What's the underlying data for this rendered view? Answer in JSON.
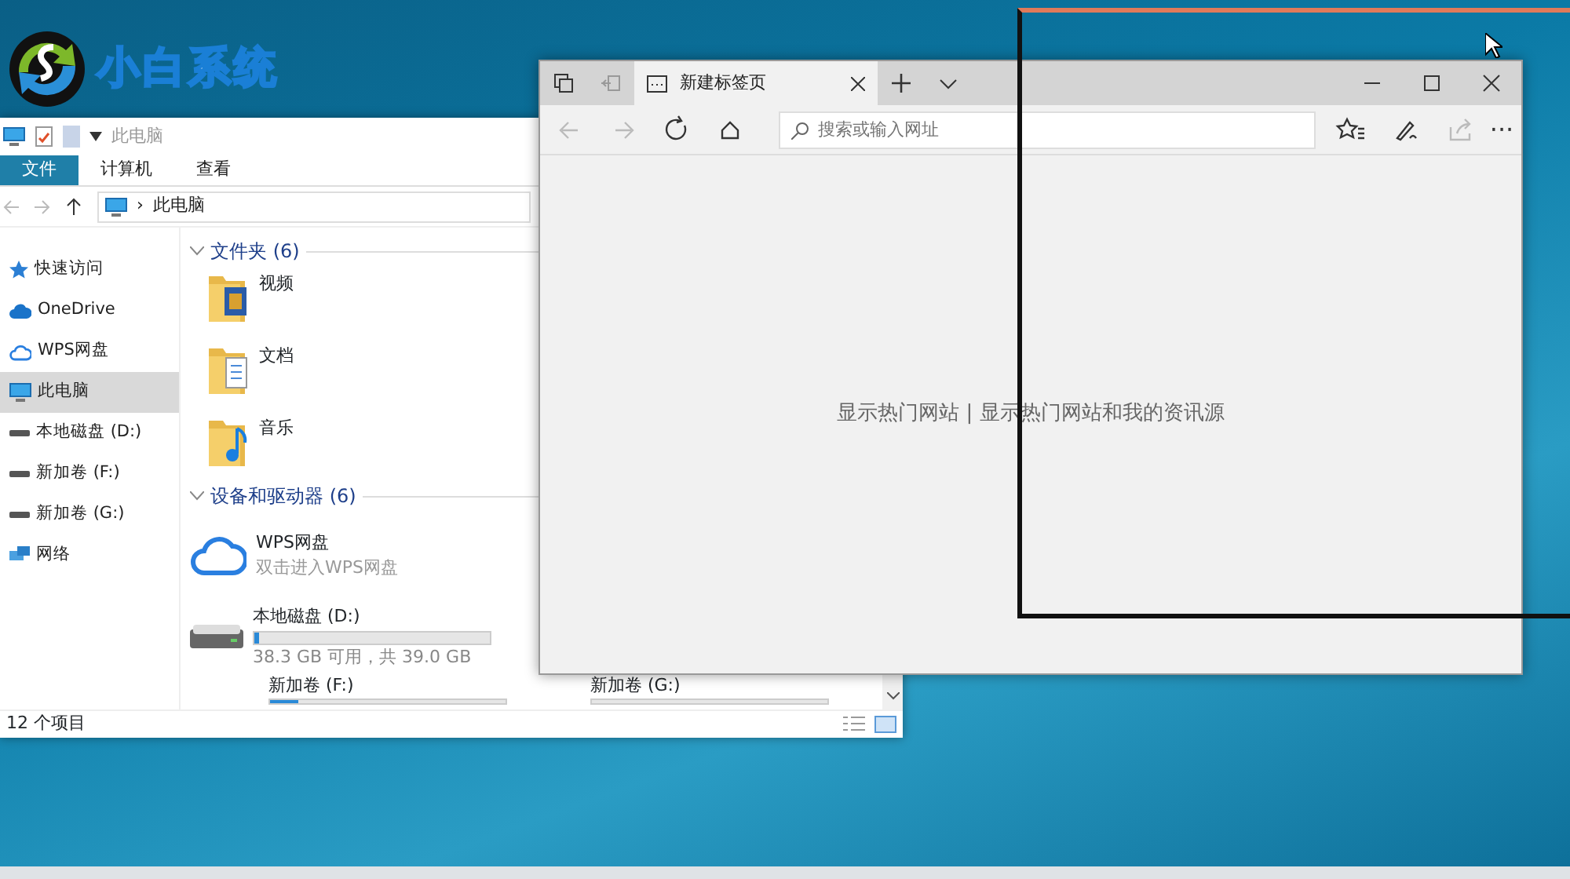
{
  "logo": {
    "text": "小白系统"
  },
  "explorer": {
    "title": "此电脑",
    "ribbon_tabs": [
      {
        "label": "文件",
        "selected": true
      },
      {
        "label": "计算机",
        "selected": false
      },
      {
        "label": "查看",
        "selected": false
      }
    ],
    "address": {
      "separator": "›",
      "path": "此电脑"
    },
    "sidebar": [
      {
        "label": "快速访问",
        "kind": "star",
        "selected": false
      },
      {
        "label": "OneDrive",
        "kind": "cloud",
        "selected": false
      },
      {
        "label": "WPS网盘",
        "kind": "cloudoutline",
        "selected": false
      },
      {
        "label": "此电脑",
        "kind": "pc",
        "selected": true
      },
      {
        "label": "本地磁盘 (D:)",
        "kind": "drive",
        "selected": false
      },
      {
        "label": "新加卷 (F:)",
        "kind": "drive",
        "selected": false
      },
      {
        "label": "新加卷 (G:)",
        "kind": "drive",
        "selected": false
      },
      {
        "label": "网络",
        "kind": "network",
        "selected": false
      }
    ],
    "groups": [
      {
        "title": "文件夹 (6)",
        "expanded": true,
        "kind": "folders",
        "items": [
          {
            "name": "视频",
            "kind": "video"
          },
          {
            "name": "文档",
            "kind": "document"
          },
          {
            "name": "音乐",
            "kind": "music"
          }
        ]
      },
      {
        "title": "设备和驱动器 (6)",
        "expanded": true,
        "kind": "drives",
        "items": [
          {
            "name": "WPS网盘",
            "kind": "cloud",
            "subtitle": "双击进入WPS网盘"
          },
          {
            "name": "本地磁盘 (D:)",
            "kind": "drive",
            "level": 0.02,
            "info": "38.3 GB 可用，共 39.0 GB"
          },
          {
            "name": "新加卷 (F:)",
            "kind": "drive-small",
            "level": 0.12
          },
          {
            "name": "新加卷 (G:)",
            "kind": "drive-small-right"
          }
        ]
      }
    ],
    "status_bar": "12 个项目"
  },
  "browser": {
    "tabs": [
      {
        "label": "新建标签页",
        "selected": true
      }
    ],
    "address": {
      "placeholder": "搜索或输入网址"
    },
    "nav": [
      {
        "kind": "back",
        "disabled": true
      },
      {
        "kind": "forward",
        "disabled": true
      },
      {
        "kind": "refresh",
        "disabled": false
      },
      {
        "kind": "home",
        "disabled": false
      }
    ],
    "toolbar": [
      {
        "kind": "favorites",
        "disabled": false
      },
      {
        "kind": "pen",
        "disabled": false
      },
      {
        "kind": "share",
        "disabled": true
      },
      {
        "kind": "more",
        "disabled": false,
        "text": "···"
      }
    ],
    "content_text": "显示热门网站 | 显示热门网站和我的资讯源"
  }
}
